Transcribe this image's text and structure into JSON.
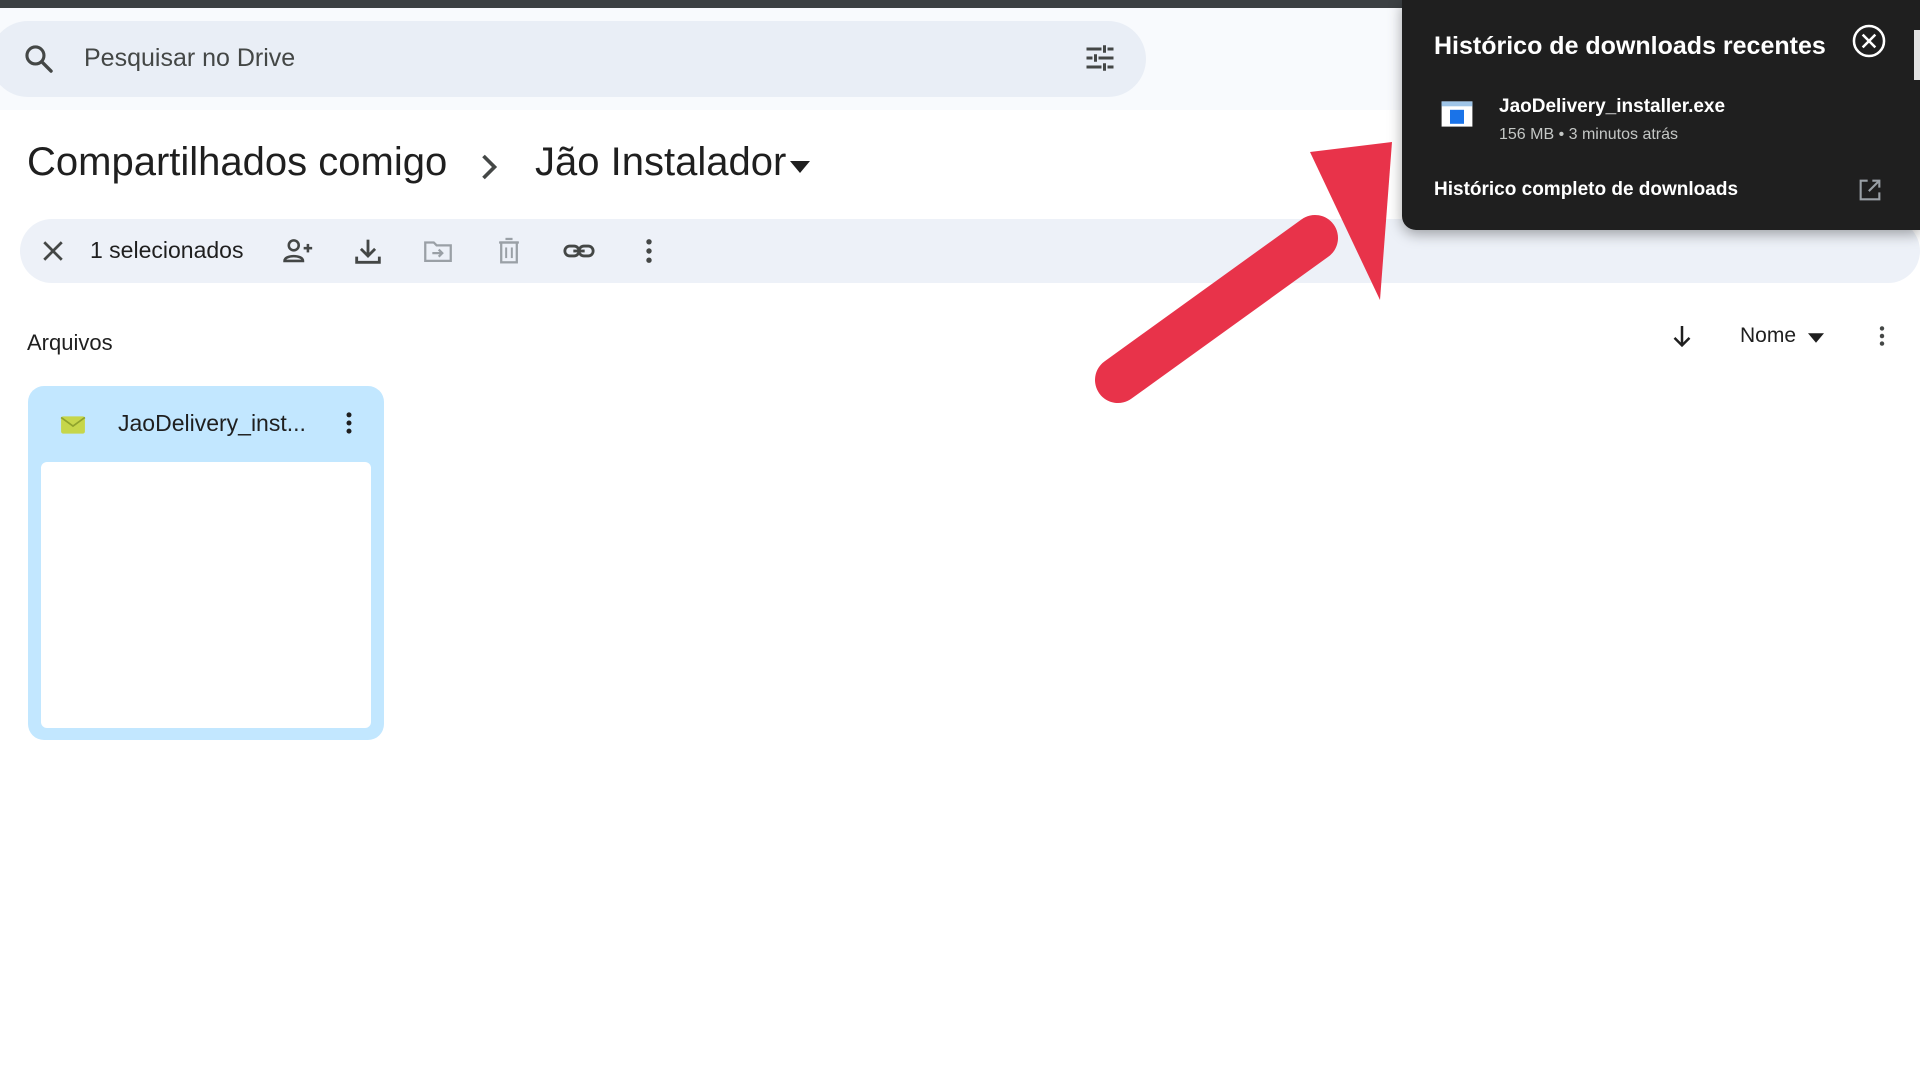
{
  "search": {
    "placeholder": "Pesquisar no Drive"
  },
  "breadcrumb": {
    "parent": "Compartilhados comigo",
    "current": "Jão Instalador"
  },
  "selection": {
    "count_label": "1 selecionados"
  },
  "files_section": {
    "label": "Arquivos",
    "sort_label": "Nome"
  },
  "file_card": {
    "name": "JaoDelivery_inst..."
  },
  "downloads_panel": {
    "title": "Histórico de downloads recentes",
    "file_name": "JaoDelivery_installer.exe",
    "file_meta": "156 MB • 3 minutos atrás",
    "full_history": "Histórico completo de downloads"
  },
  "colors": {
    "arrow": "#e8334a",
    "selected_card": "#c2e7ff",
    "panel_bg": "#1f1f1f"
  }
}
